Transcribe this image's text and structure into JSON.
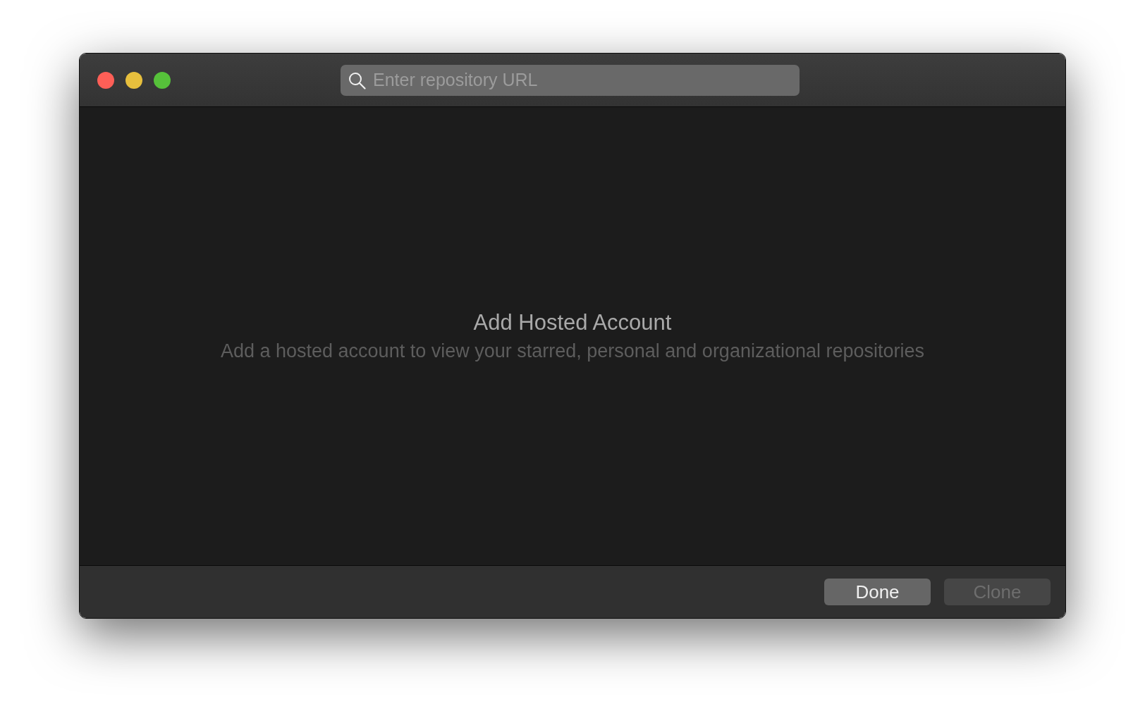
{
  "search": {
    "placeholder": "Enter repository URL"
  },
  "empty_state": {
    "title": "Add Hosted Account",
    "message": "Add a hosted account to view your starred, personal and organizational repositories"
  },
  "buttons": [
    {
      "label": "Done",
      "disabled": false
    },
    {
      "label": "Clone",
      "disabled": true
    }
  ]
}
